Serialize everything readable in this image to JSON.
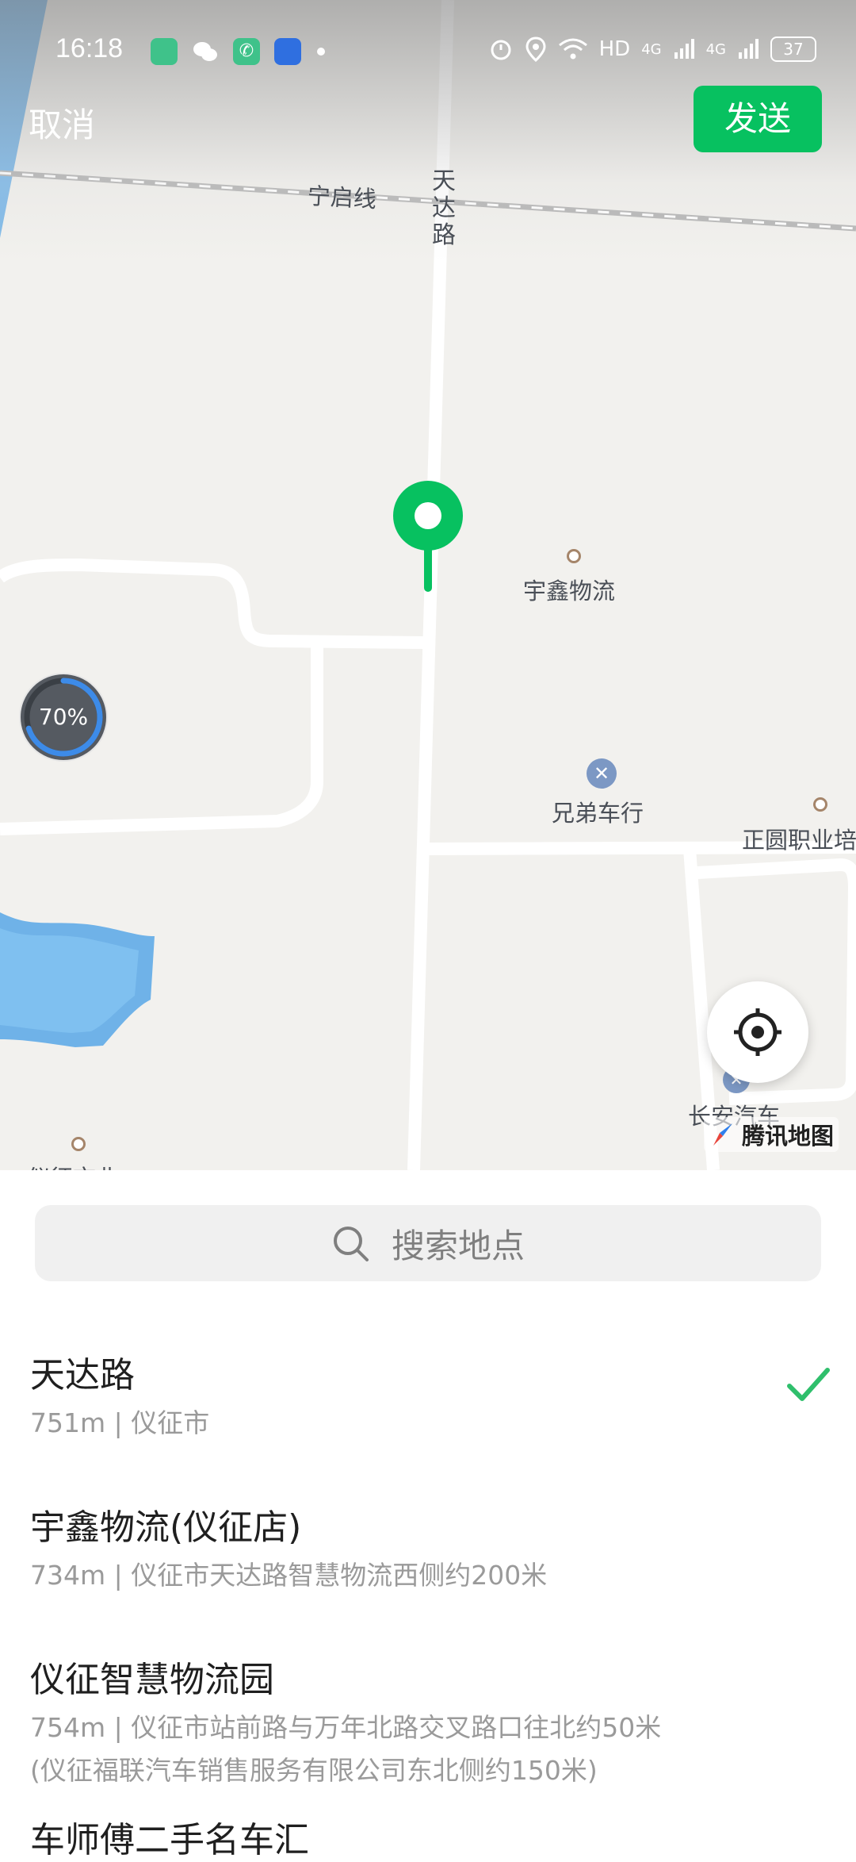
{
  "status_bar": {
    "time": "16:18",
    "network_label": "HD",
    "signal_1": "4G",
    "signal_2": "4G",
    "battery": "37"
  },
  "header": {
    "cancel_label": "取消",
    "send_label": "发送"
  },
  "map": {
    "labels": {
      "rail": "宁启线",
      "road": "天达路",
      "poi_1": "宇鑫物流",
      "poi_2": "兄弟车行",
      "poi_3": "正圆职业培",
      "poi_4": "长安汽车",
      "poi_5": "仪征市北"
    },
    "gauge_percent": "70%",
    "brand": "腾讯地图"
  },
  "search": {
    "placeholder": "搜索地点"
  },
  "results": [
    {
      "name": "天达路",
      "detail": "751m | 仪征市",
      "detail2": "",
      "selected": true
    },
    {
      "name": "宇鑫物流(仪征店)",
      "detail": "734m | 仪征市天达路智慧物流西侧约200米",
      "detail2": ""
    },
    {
      "name": "仪征智慧物流园",
      "detail": "754m | 仪征市站前路与万年北路交叉路口往北约50米",
      "detail2": "(仪征福联汽车销售服务有限公司东北侧约150米)"
    },
    {
      "name": "车师傅二手名车汇",
      "detail": "",
      "detail2": ""
    }
  ],
  "colors": {
    "accent": "#07c160",
    "check": "#2fbf6c",
    "water": "#6fb2e8"
  }
}
